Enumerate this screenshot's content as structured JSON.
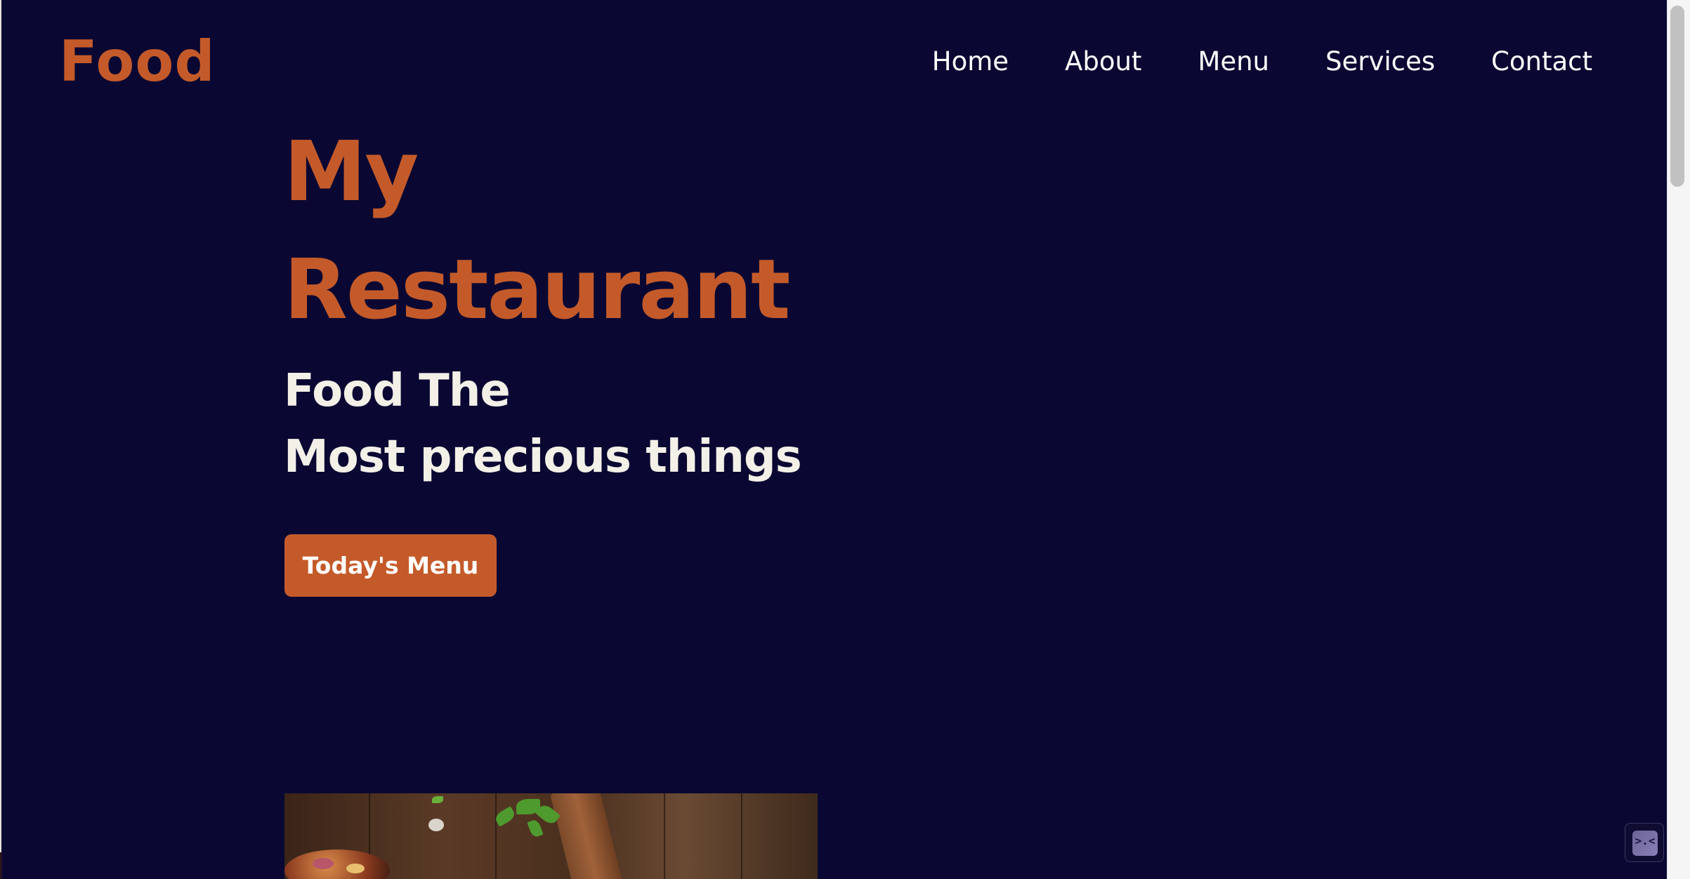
{
  "header": {
    "logo": "Food",
    "nav": [
      {
        "label": "Home"
      },
      {
        "label": "About"
      },
      {
        "label": "Menu"
      },
      {
        "label": "Services"
      },
      {
        "label": "Contact"
      }
    ]
  },
  "hero": {
    "title_line1": "My",
    "title_line2": "Restaurant",
    "tagline_line1": "Food The",
    "tagline_line2": "Most precious things",
    "cta_label": "Today's Menu"
  },
  "image": {
    "alt": "food"
  },
  "widget": {
    "glyph": ">.<"
  },
  "colors": {
    "background": "#0a0832",
    "accent": "#c45a2a",
    "text": "#f3f0e8"
  }
}
